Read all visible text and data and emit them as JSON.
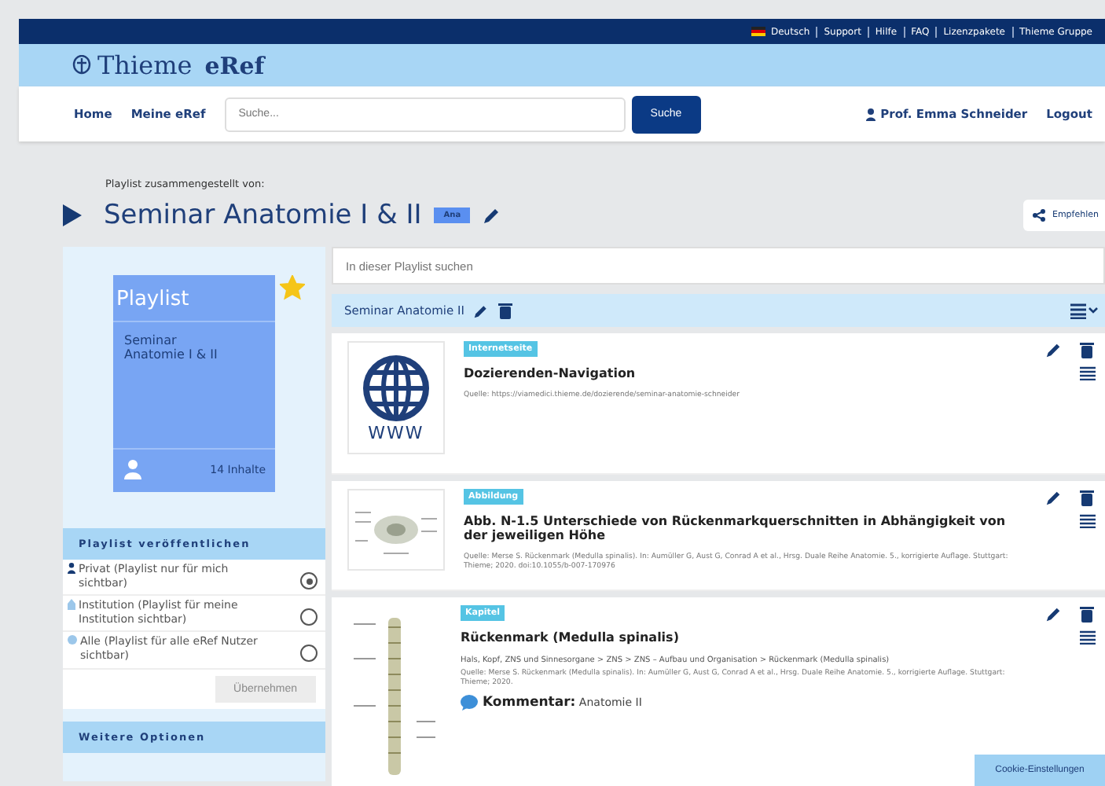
{
  "top_links": [
    {
      "label": "Deutsch",
      "kind": "language"
    },
    {
      "label": "Support",
      "kind": "link"
    },
    {
      "label": "Hilfe",
      "kind": "link"
    },
    {
      "label": "FAQ",
      "kind": "link"
    },
    {
      "label": "Lizenzpakete",
      "kind": "link"
    },
    {
      "label": "Thieme Gruppe",
      "kind": "link"
    }
  ],
  "brand": {
    "name": "Thieme",
    "product": "eRef"
  },
  "nav": {
    "items": [
      "Home",
      "Meine eRef"
    ],
    "search_placeholder": "Suche...",
    "search_button": "Suche",
    "user": "Prof. Emma Schneider",
    "logout": "Logout"
  },
  "playlist": {
    "caption": "Playlist zusammengestellt von:",
    "title": "Seminar Anatomie I & II",
    "badge": "Ana",
    "recommend": "Empfehlen"
  },
  "card": {
    "label": "Playlist",
    "title": "Seminar Anatomie I & II",
    "count": "14 Inhalte",
    "favorite": true
  },
  "publish": {
    "heading": "Playlist veröffentlichen",
    "options": [
      {
        "label": "Privat (Playlist nur für mich sichtbar)",
        "kind": "person",
        "selected": true
      },
      {
        "label": "Institution (Playlist für meine Institution sichtbar)",
        "kind": "institution",
        "selected": false
      },
      {
        "label": "Alle (Playlist für alle eRef Nutzer sichtbar)",
        "kind": "globe",
        "selected": false
      }
    ],
    "button": "Übernehmen",
    "button_disabled": true
  },
  "more_heading": "Weitere Optionen",
  "search_placeholder": "In dieser Playlist suchen",
  "group": {
    "title": "Seminar Anatomie II"
  },
  "items": [
    {
      "kind": "web",
      "thumb_label": "WWW",
      "tag": "Internetseite",
      "title": "Dozierenden-Navigation",
      "source": "Quelle: https://viamedici.thieme.de/dozierende/seminar-anatomie-schneider"
    },
    {
      "kind": "figure",
      "tag": "Abbildung",
      "title": "Abb. N-1.5 Unterschiede von Rückenmarkquerschnitten in Abhängigkeit von der jeweiligen Höhe",
      "source": "Quelle: Merse S. Rückenmark (Medulla spinalis). In: Aumüller G, Aust G, Conrad A et al., Hrsg. Duale Reihe Anatomie. 5., korrigierte Auflage. Stuttgart: Thieme; 2020. doi:10.1055/b-007-170976"
    },
    {
      "kind": "chapter",
      "tag": "Kapitel",
      "title": "Rückenmark (Medulla spinalis)",
      "path": "Hals, Kopf, ZNS und Sinnesorgane > ZNS > ZNS – Aufbau und Organisation > Rückenmark (Medulla spinalis)",
      "source": "Quelle: Merse S. Rückenmark (Medulla spinalis). In: Aumüller G, Aust G, Conrad A et al., Hrsg. Duale Reihe Anatomie. 5., korrigierte Auflage. Stuttgart: Thieme; 2020.",
      "comment_label": "Kommentar:",
      "comment": "Anatomie II"
    }
  ],
  "cookie_button": "Cookie-Einstellungen"
}
